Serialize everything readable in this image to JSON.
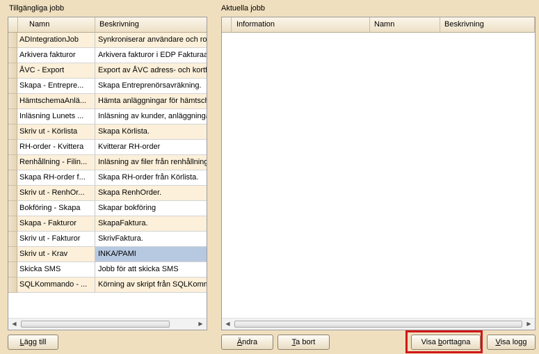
{
  "left_group": {
    "title": "Tillgängliga jobb",
    "columns": [
      "Namn",
      "Beskrivning"
    ],
    "rows": [
      {
        "name": "ADIntegrationJob",
        "desc": "Synkroniserar användare och roller mot AD"
      },
      {
        "name": "Arkivera fakturor",
        "desc": "Arkivera fakturor i EDP Fakturaarkiv"
      },
      {
        "name": "ÅVC - Export",
        "desc": "Export av ÅVC adress- och kortfiler"
      },
      {
        "name": "Skapa - Entrepre...",
        "desc": "Skapa Entreprenörsavräkning."
      },
      {
        "name": "HämtschemaAnlä...",
        "desc": "Hämta anläggningar för hämtschema"
      },
      {
        "name": "Inläsning Lunets ...",
        "desc": "Inläsning av kunder, anläggningar och"
      },
      {
        "name": "Skriv ut - Körlista",
        "desc": "Skapa Körlista."
      },
      {
        "name": "RH-order - Kvittera",
        "desc": "Kvitterar RH-order"
      },
      {
        "name": "Renhållning - Filin...",
        "desc": "Inläsning av filer från renhållningsentreprenör"
      },
      {
        "name": "Skapa RH-order f...",
        "desc": "Skapa RH-order från Körlista."
      },
      {
        "name": "Skriv ut - RenhOr...",
        "desc": "Skapa RenhOrder."
      },
      {
        "name": "Bokföring - Skapa",
        "desc": "Skapar bokföring"
      },
      {
        "name": "Skapa - Fakturor",
        "desc": "SkapaFaktura."
      },
      {
        "name": "Skriv ut - Fakturor",
        "desc": "SkrivFaktura."
      },
      {
        "name": "Skriv ut - Krav",
        "desc": "INKA/PAMI"
      },
      {
        "name": "Skicka SMS",
        "desc": "Jobb för att skicka SMS"
      },
      {
        "name": "SQLKommando - ...",
        "desc": "Körning av skript från SQLKommando"
      }
    ],
    "selected_index": 14
  },
  "right_group": {
    "title": "Aktuella jobb",
    "columns": [
      "Information",
      "Namn",
      "Beskrivning"
    ]
  },
  "buttons": {
    "add": {
      "pre": "",
      "mnemonic": "L",
      "post": "ägg till"
    },
    "change": {
      "pre": "",
      "mnemonic": "Ä",
      "post": "ndra"
    },
    "remove": {
      "pre": "",
      "mnemonic": "T",
      "post": "a bort"
    },
    "show_deleted": {
      "pre": "Visa ",
      "mnemonic": "b",
      "post": "orttagna"
    },
    "show_log": {
      "pre": "",
      "mnemonic": "V",
      "post": "isa logg"
    }
  },
  "colors": {
    "background": "#f0dfbe",
    "row_alt": "#fcf0da",
    "row_selected": "#b7c9e1",
    "highlight_border": "#d01717"
  }
}
